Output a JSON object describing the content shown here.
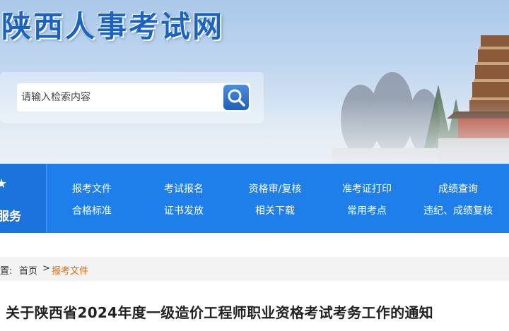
{
  "header": {
    "site_title": "陕西人事考试网"
  },
  "search": {
    "placeholder": "请输入检索内容"
  },
  "nav": {
    "side_label": "服务",
    "row1": [
      "报考文件",
      "考试报名",
      "资格审/复核",
      "准考证打印",
      "成绩查询"
    ],
    "row2": [
      "合格标准",
      "证书发放",
      "相关下载",
      "常用考点",
      "违纪、成绩复核"
    ]
  },
  "breadcrumb": {
    "prefix": "置:",
    "home": "首页",
    "separator": ">",
    "current": "报考文件"
  },
  "article": {
    "title": "关于陕西省2024年度一级造价工程师职业资格考试考务工作的通知"
  },
  "colors": {
    "nav_blue": "#1e7fea",
    "title_blue": "#1a63c2",
    "breadcrumb_active": "#e36a0a"
  }
}
